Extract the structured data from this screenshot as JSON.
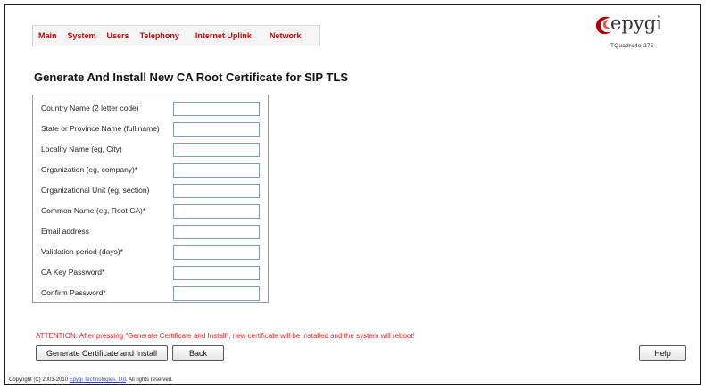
{
  "nav": {
    "items": [
      "Main",
      "System",
      "Users",
      "Telephony",
      "Internet Uplink",
      "Network"
    ]
  },
  "logo": {
    "brand": "epygi",
    "model": "TQuadro4e-275"
  },
  "page": {
    "title": "Generate And Install New CA Root Certificate for SIP TLS"
  },
  "form": {
    "fields": [
      {
        "label": "Country Name (2 letter code)",
        "value": ""
      },
      {
        "label": "State or Province Name (full name)",
        "value": ""
      },
      {
        "label": "Locality Name (eg, City)",
        "value": ""
      },
      {
        "label": "Organization (eg, company)*",
        "value": ""
      },
      {
        "label": "Organizational Unit (eg, section)",
        "value": ""
      },
      {
        "label": "Common Name (eg, Root CA)*",
        "value": ""
      },
      {
        "label": "Email address",
        "value": ""
      },
      {
        "label": "Validation period (days)*",
        "value": ""
      },
      {
        "label": "CA Key Password*",
        "value": ""
      },
      {
        "label": "Confirm Password*",
        "value": ""
      }
    ]
  },
  "attention": "ATTENTION: After pressing \"Generate Certificate and Install\", new certificate will be installed and the system will reboot!",
  "buttons": {
    "generate": "Generate Certificate and Install",
    "back": "Back",
    "help": "Help"
  },
  "footer": {
    "prefix": "Copyright (C) 2003-2010 ",
    "link": "Epygi Technologies, Ltd",
    "suffix": ". All rights reserved."
  },
  "colors": {
    "nav_text": "#cc0000",
    "attention": "#ff1a1a",
    "logo_swoosh": "#b30000"
  }
}
